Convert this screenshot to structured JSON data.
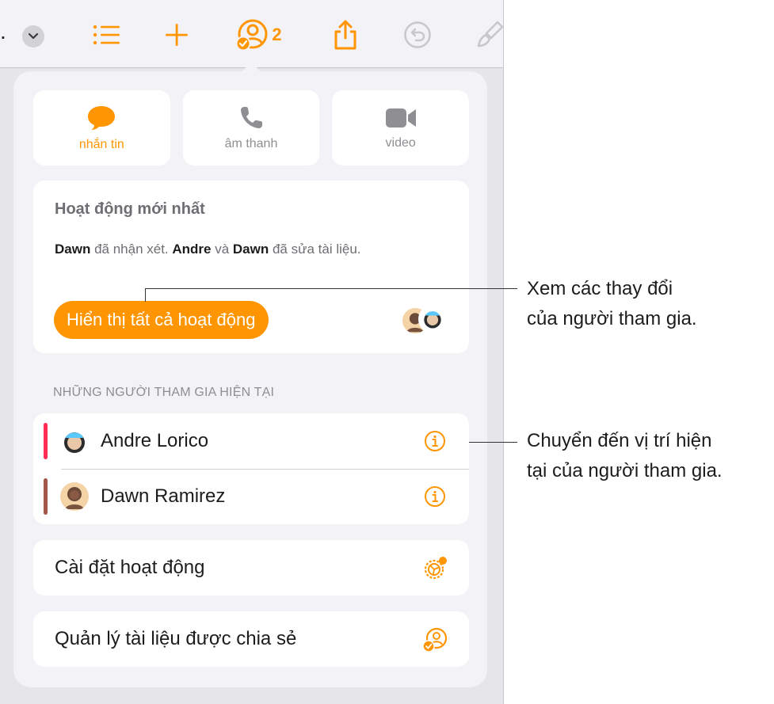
{
  "toolbar": {
    "truncated_text": ".",
    "collaborator_count": "2",
    "icons": [
      "chevron-down-icon",
      "list-icon",
      "plus-icon",
      "collaborate-icon",
      "share-icon",
      "undo-icon",
      "paintbrush-icon"
    ]
  },
  "contact": {
    "message_label": "nhắn tin",
    "audio_label": "âm thanh",
    "video_label": "video"
  },
  "activity": {
    "title": "Hoạt động mới nhất",
    "text_name1": "Dawn",
    "text_part1": " đã nhận xét. ",
    "text_name2": "Andre",
    "text_part2": " và ",
    "text_name3": "Dawn",
    "text_part3": " đã sửa tài liệu.",
    "show_all_label": "Hiển thị tất cả hoạt động"
  },
  "participants": {
    "header": "NHỮNG NGƯỜI THAM GIA HIỆN TẠI",
    "list": [
      {
        "name": "Andre Lorico",
        "color": "#ff2d55"
      },
      {
        "name": "Dawn Ramirez",
        "color": "#a2574a"
      }
    ]
  },
  "menu": {
    "activity_settings": "Cài đặt hoạt động",
    "manage_shared": "Quản lý tài liệu được chia sẻ"
  },
  "callouts": {
    "first_line1": "Xem các thay đổi",
    "first_line2": "của người tham gia.",
    "second_line1": "Chuyển đến vị trí hiện",
    "second_line2": "tại của người tham gia."
  },
  "colors": {
    "accent": "#ff9500",
    "panel": "#f2f2f7"
  }
}
